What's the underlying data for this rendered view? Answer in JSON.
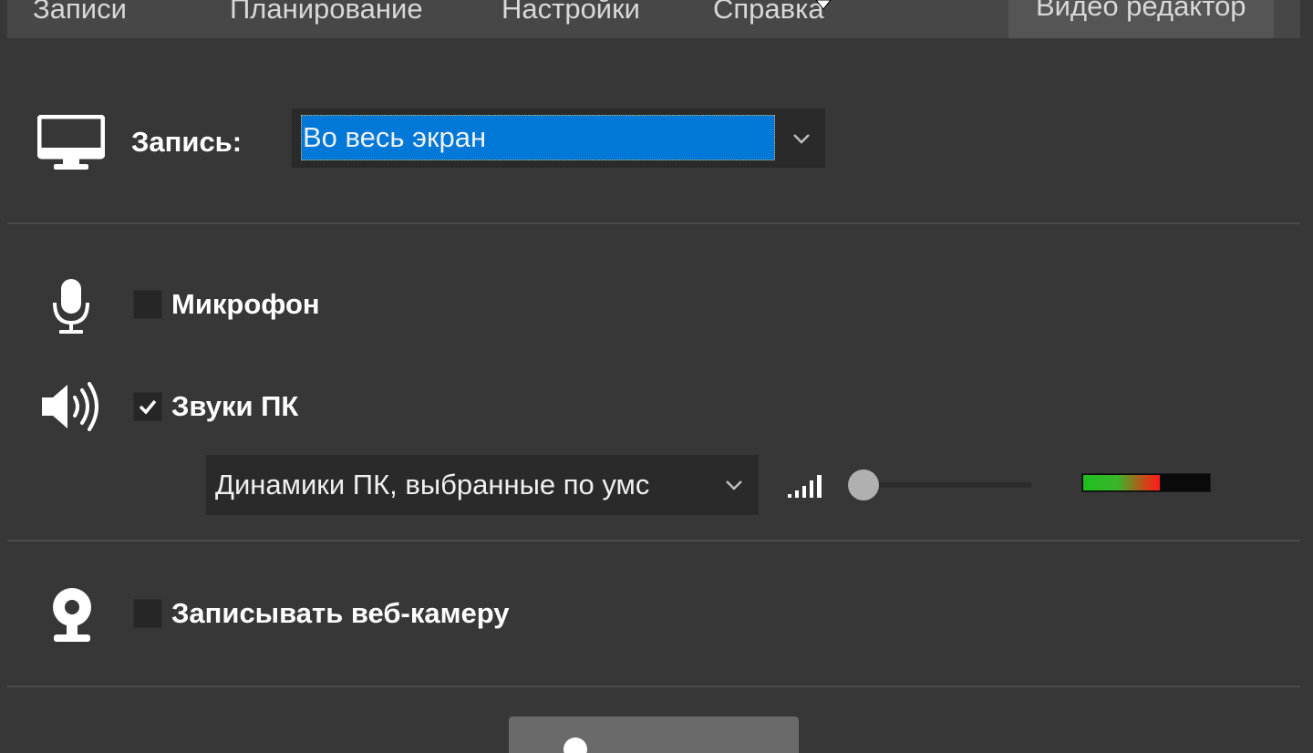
{
  "menu": {
    "items": [
      "Записи",
      "Планирование",
      "Настройки",
      "Справка"
    ],
    "right_item": "Видео редактор"
  },
  "record": {
    "label": "Запись:",
    "selected": "Во весь экран",
    "icon": "monitor-icon"
  },
  "audio": {
    "microphone_label": "Микрофон",
    "microphone_checked": false,
    "pc_sounds_label": "Звуки ПК",
    "pc_sounds_checked": true,
    "device_selected": "Динамики ПК, выбранные по умс",
    "volume_level": 0.0,
    "signal_level": 0.6
  },
  "webcam": {
    "label": "Записывать веб-камеру",
    "checked": false
  },
  "colors": {
    "background": "#373737",
    "menubar": "#474747",
    "selection": "#0078d7",
    "dropdown": "#2a2a2a"
  }
}
